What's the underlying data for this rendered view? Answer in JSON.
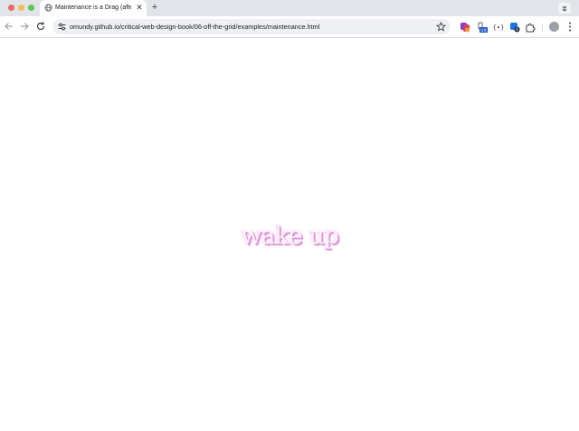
{
  "browser": {
    "tab": {
      "title": "Maintenance is a Drag (after",
      "close_label": "✕"
    },
    "new_tab_label": "+",
    "address_bar": {
      "url": "omundy.github.io/critical-web-design-book/06-off-the-grid/examples/maintenance.html"
    },
    "icons": {
      "back": "arrow-left-icon",
      "forward": "arrow-right-icon",
      "reload": "reload-icon",
      "site_info": "tune-icon",
      "bookmark": "star-icon",
      "extensions": "puzzle-icon",
      "menu": "kebab-menu-icon"
    },
    "colors": {
      "tabstrip": "#e1e4e8",
      "omnibox": "#eef0f3",
      "close_dot": "#ed6a5e",
      "minimize_dot": "#f5bf4f",
      "zoom_dot": "#61c454"
    }
  },
  "page": {
    "headline": "wake up",
    "colors": {
      "text_fill": "#fcf0fa",
      "text_shadow": "#d98ad3",
      "background": "#ffffff"
    }
  }
}
